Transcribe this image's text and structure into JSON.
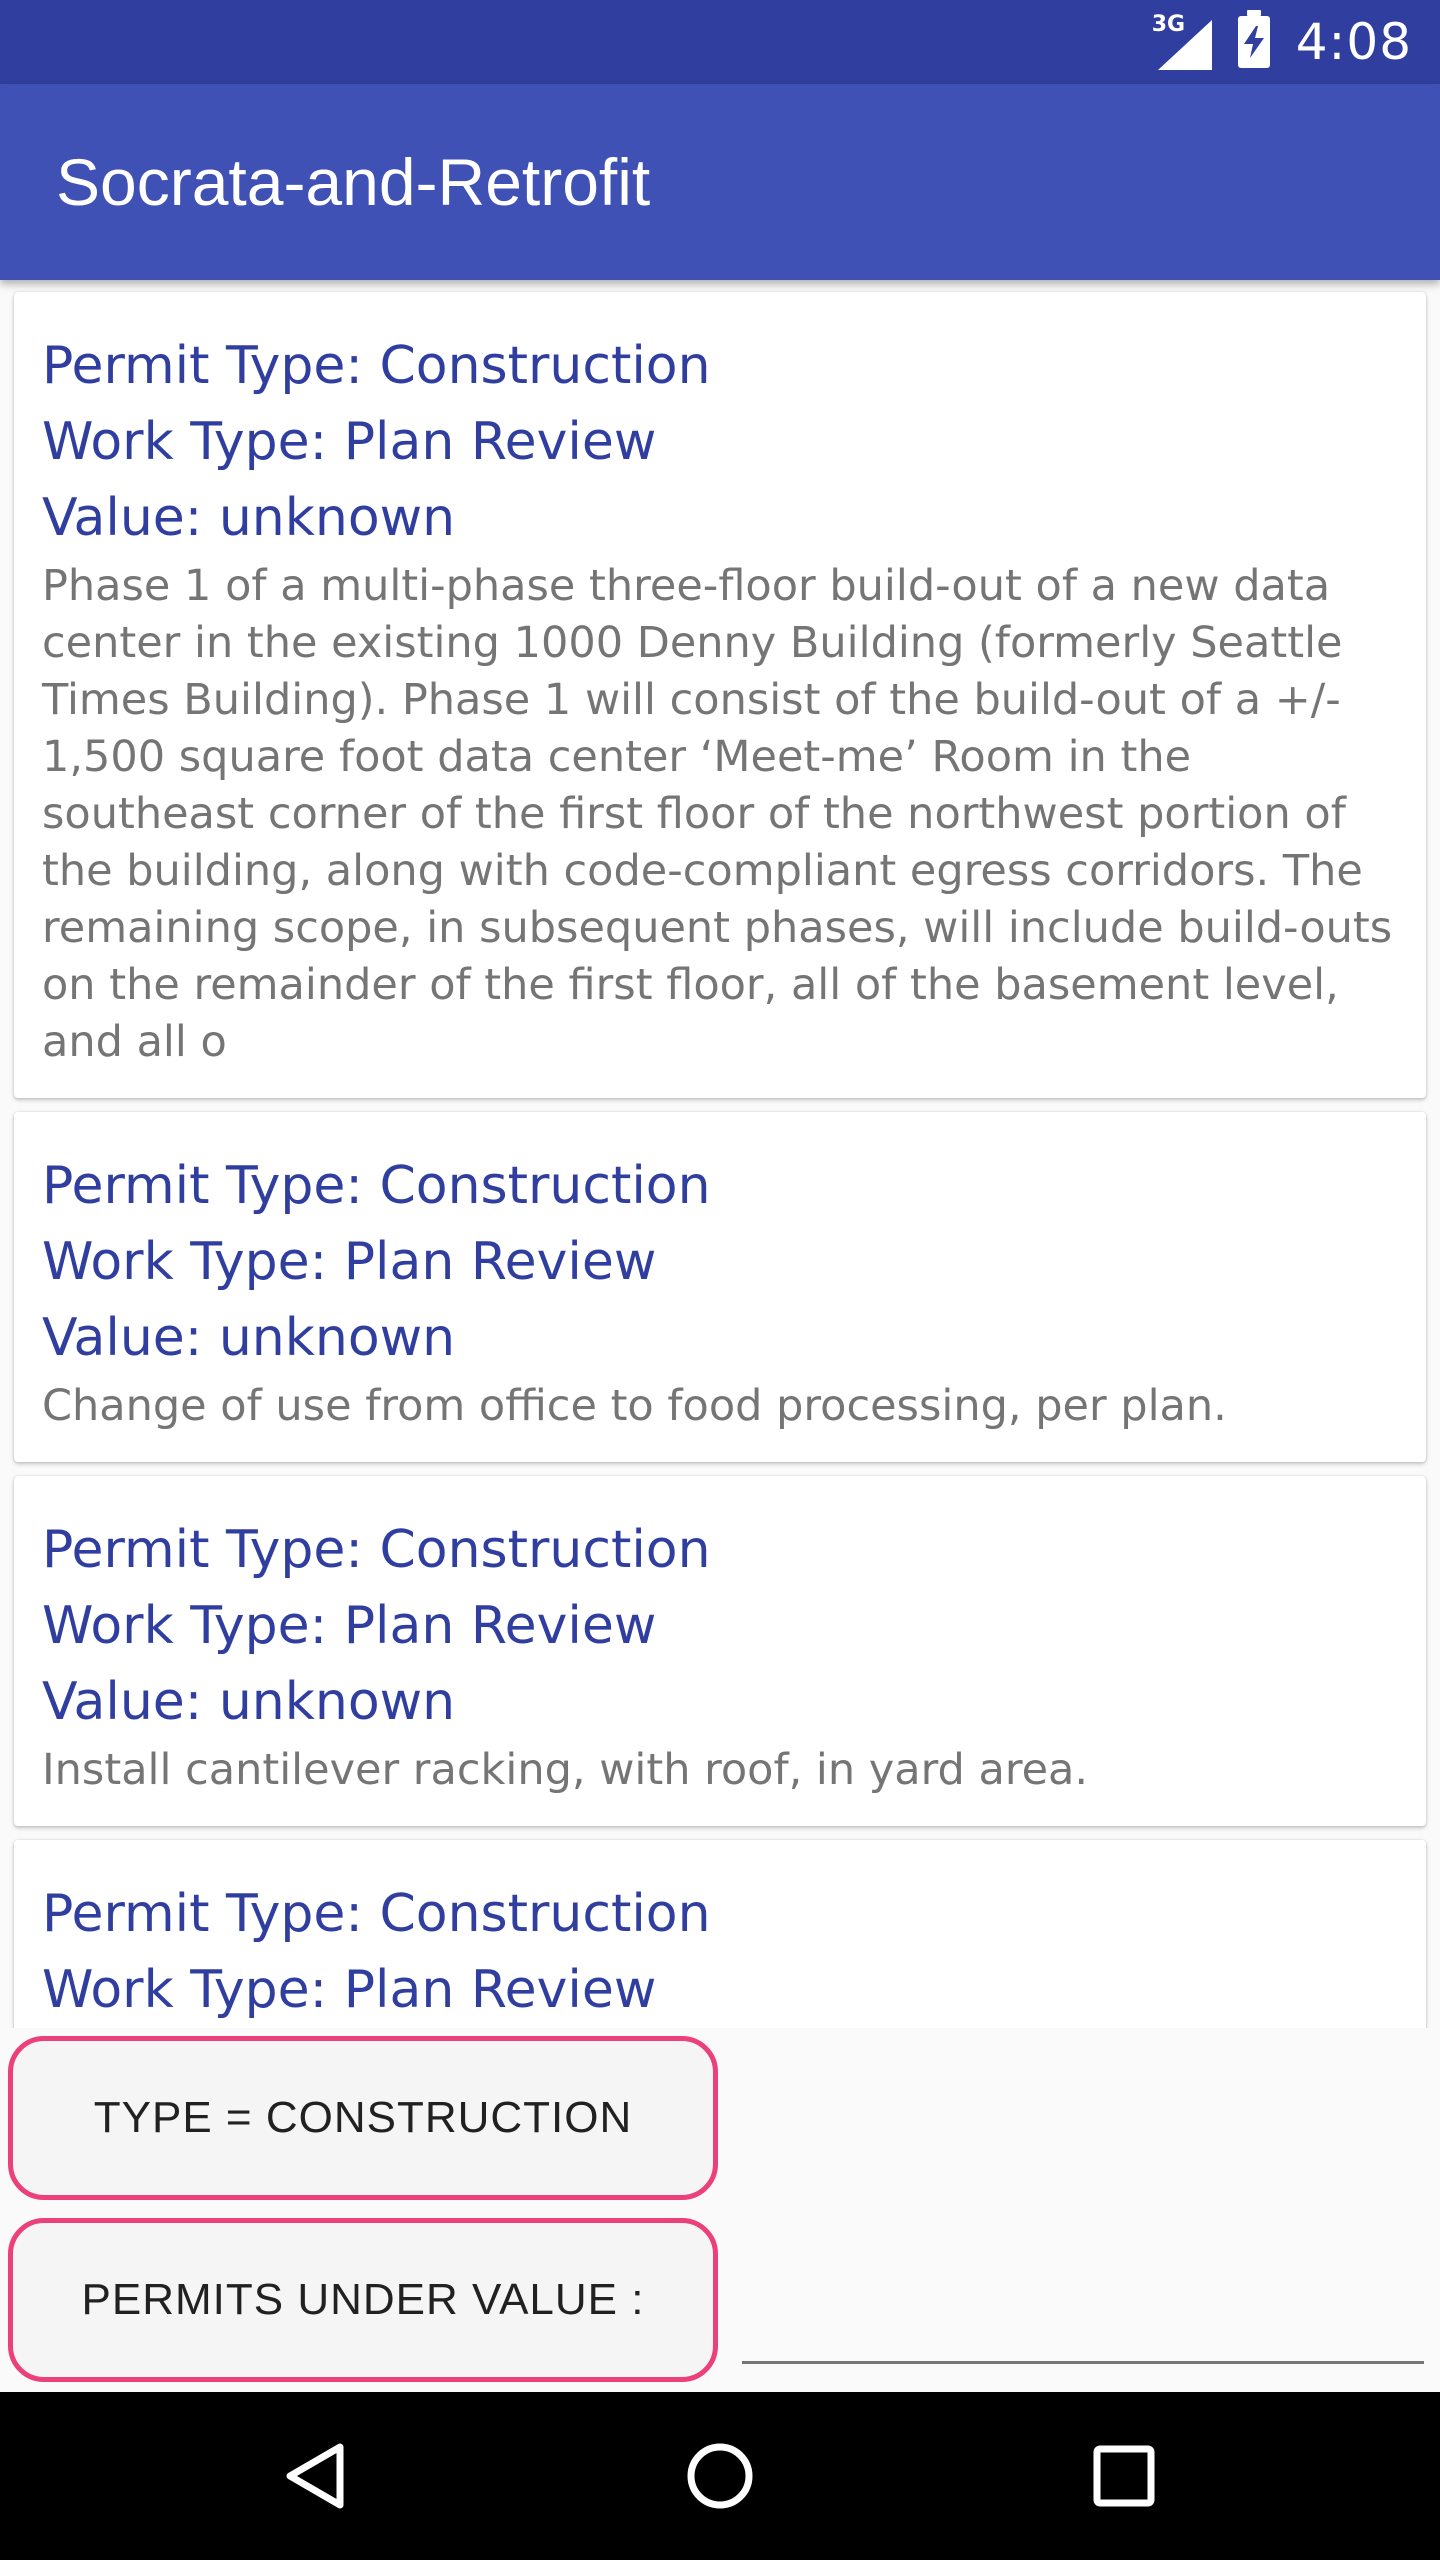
{
  "status_bar": {
    "network": "3G",
    "time": "4:08"
  },
  "app_bar": {
    "title": "Socrata-and-Retrofit"
  },
  "permits": [
    {
      "permit_type": "Permit Type: Construction",
      "work_type": "Work Type: Plan Review",
      "value": "Value: unknown",
      "description": "Phase 1 of a multi-phase three-floor build-out of a new data center in the existing 1000 Denny Building (formerly Seattle Times Building). Phase 1 will consist of the build-out of a +/- 1,500 square foot data center ‘Meet-me’ Room in the southeast corner of the first floor of the northwest portion of the building, along with code-compliant egress corridors. The remaining scope, in subsequent phases, will include build-outs on the remainder of the first floor, all of the basement level, and all o"
    },
    {
      "permit_type": "Permit Type: Construction",
      "work_type": "Work Type: Plan Review",
      "value": "Value: unknown",
      "description": "Change of use from office to food processing, per plan."
    },
    {
      "permit_type": "Permit Type: Construction",
      "work_type": "Work Type: Plan Review",
      "value": "Value: unknown",
      "description": "Install cantilever racking, with roof, in yard area."
    },
    {
      "permit_type": "Permit Type: Construction",
      "work_type": "Work Type: Plan Review"
    }
  ],
  "filters": {
    "type_button_label": "TYPE = CONSTRUCTION",
    "value_button_label": "PERMITS UNDER VALUE :",
    "value_input_value": "",
    "value_input_placeholder": ""
  },
  "navigation": {
    "back_icon": "back-triangle-icon",
    "home_icon": "home-circle-icon",
    "recents_icon": "recents-square-icon"
  },
  "colors": {
    "status_bar": "#303f9f",
    "app_bar": "#3f51b5",
    "title_text": "#303f9f",
    "description_text": "#757575",
    "button_border": "#ec407a"
  }
}
